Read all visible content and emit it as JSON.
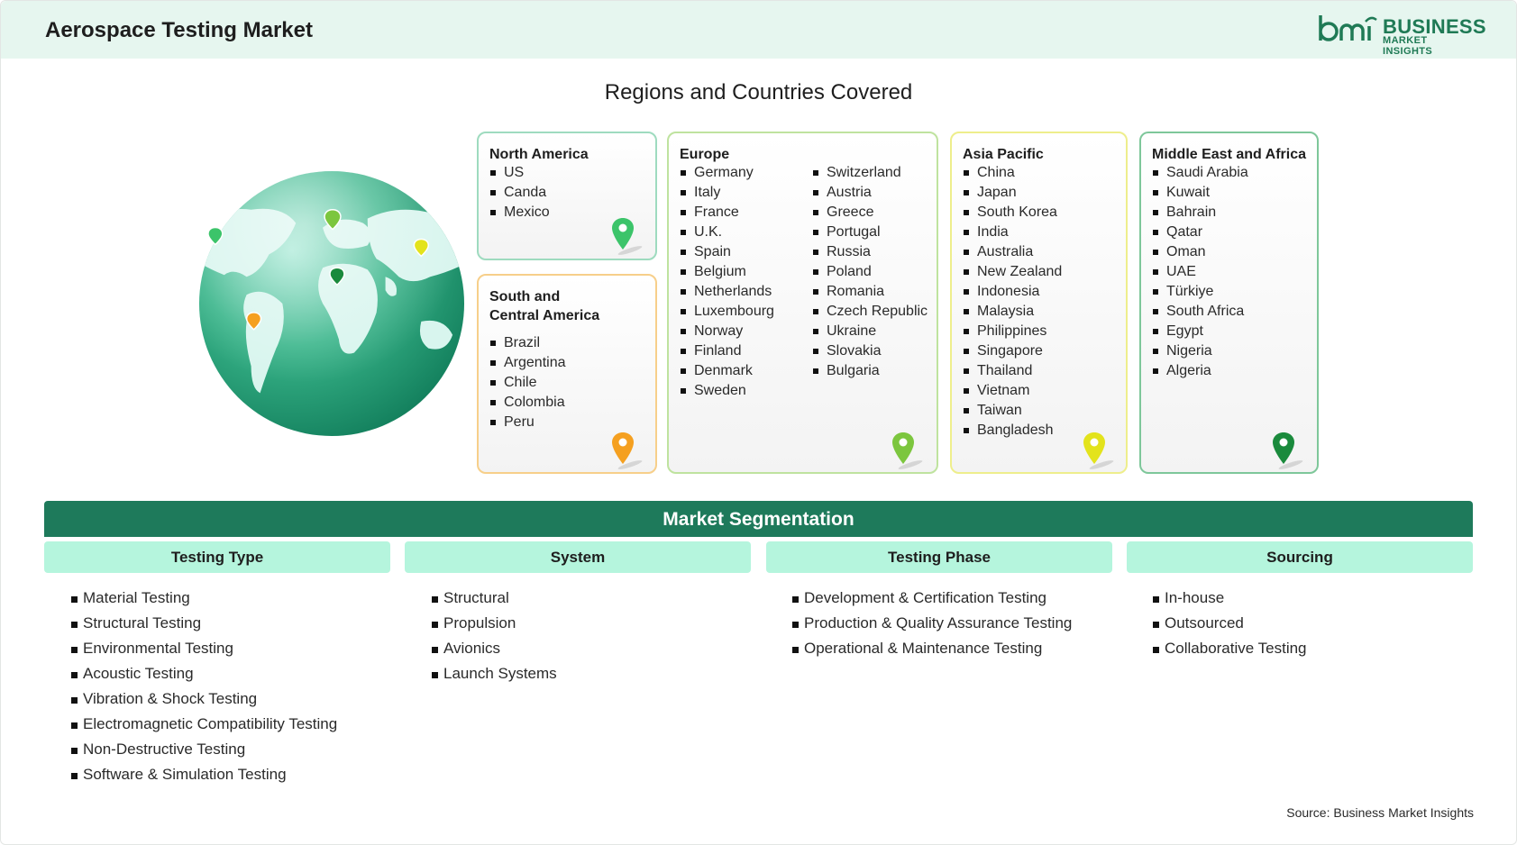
{
  "header": {
    "title": "Aerospace Testing Market",
    "logo_text": "BUSINESS",
    "logo_subtext": "MARKET INSIGHTS",
    "brand_color": "#1f7a55"
  },
  "regions": {
    "title": "Regions and Countries Covered",
    "north_america": {
      "title": "North America",
      "items": [
        "US",
        "Canda",
        "Mexico"
      ],
      "pin_color": "#3cc46a",
      "border_color": "#9edbbf"
    },
    "south_central_america": {
      "title_line1": "South and",
      "title_line2": "Central America",
      "items": [
        "Brazil",
        "Argentina",
        "Chile",
        "Colombia",
        "Peru"
      ],
      "pin_color": "#f5a020",
      "border_color": "#f7cf8a"
    },
    "europe": {
      "title": "Europe",
      "items_col1": [
        "Germany",
        "Italy",
        "France",
        "U.K.",
        "Spain",
        "Belgium",
        "Netherlands",
        "Luxembourg",
        "Norway",
        "Finland",
        "Denmark",
        "Sweden"
      ],
      "items_col2": [
        "Switzerland",
        "Austria",
        "Greece",
        "Portugal",
        "Russia",
        "Poland",
        "Romania",
        "Czech Republic",
        "Ukraine",
        "Slovakia",
        "Bulgaria"
      ],
      "pin_color": "#7cc63e",
      "border_color": "#bfe39f"
    },
    "asia_pacific": {
      "title": "Asia Pacific",
      "items": [
        "China",
        "Japan",
        "South Korea",
        "India",
        "Australia",
        "New Zealand",
        "Indonesia",
        "Malaysia",
        "Philippines",
        "Singapore",
        "Thailand",
        "Vietnam",
        "Taiwan",
        "Bangladesh"
      ],
      "pin_color": "#e3e31c",
      "border_color": "#eeee8c"
    },
    "middle_east_africa": {
      "title": "Middle East and Africa",
      "items": [
        "Saudi Arabia",
        "Kuwait",
        "Bahrain",
        "Qatar",
        "Oman",
        "UAE",
        "Türkiye",
        "South Africa",
        "Egypt",
        "Nigeria",
        "Algeria"
      ],
      "pin_color": "#1a8a3c",
      "border_color": "#7ec79a"
    }
  },
  "segmentation": {
    "title": "Market Segmentation",
    "columns": [
      {
        "title": "Testing Type",
        "items": [
          "Material Testing",
          "Structural Testing",
          "Environmental Testing",
          "Acoustic Testing",
          "Vibration & Shock Testing",
          "Electromagnetic Compatibility Testing",
          "Non-Destructive Testing",
          "Software & Simulation Testing"
        ]
      },
      {
        "title": "System",
        "items": [
          "Structural",
          "Propulsion",
          "Avionics",
          "Launch Systems"
        ]
      },
      {
        "title": "Testing Phase",
        "items": [
          "Development & Certification Testing",
          "Production & Quality Assurance Testing",
          "Operational & Maintenance Testing"
        ]
      },
      {
        "title": "Sourcing",
        "items": [
          "In-house",
          "Outsourced",
          "Collaborative Testing"
        ]
      }
    ]
  },
  "source": "Source: Business Market Insights"
}
